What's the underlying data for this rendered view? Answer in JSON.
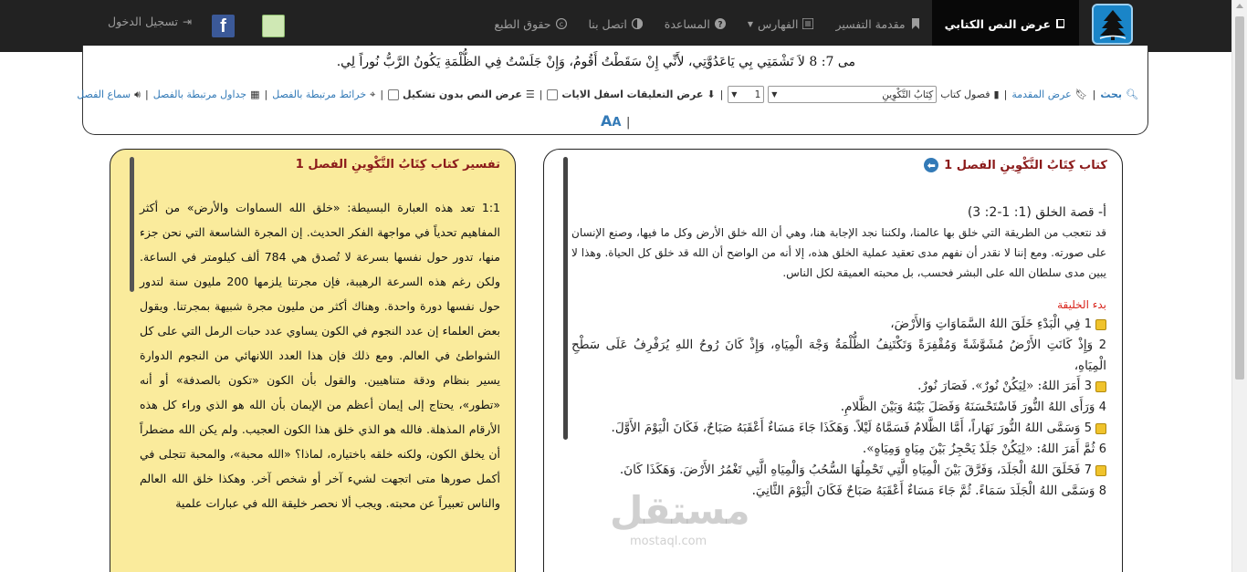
{
  "navbar": {
    "items": [
      {
        "label": "عرض النص الكتابي",
        "icon": "book-icon",
        "active": true
      },
      {
        "label": "مقدمة التفسير",
        "icon": "bookmark-icon"
      },
      {
        "label": "الفهارس",
        "icon": "list-icon",
        "dropdown": true
      },
      {
        "label": "المساعدة",
        "icon": "question-icon"
      },
      {
        "label": "اتصل بنا",
        "icon": "contrast-icon"
      },
      {
        "label": "حقوق الطبع",
        "icon": "copyright-icon"
      }
    ],
    "login_label": "تسجيل الدخول",
    "facebook_letter": "f"
  },
  "top": {
    "verse": "مى 7: 8 لاَ تَشْمَتِي بِي يَاعَدُوَّتِي، لأَنِّي إِنْ سَقَطْتُ أَقُومُ، وَإِنْ جَلَسْتُ فِي الظُّلْمَةِ يَكُونُ الرَّبُّ نُوراً لِي.",
    "search_label": "بحث",
    "intro_label": "عرض المقدمة",
    "chapters_label": "فصول كتاب",
    "book_select": "كِتَابُ التَّكْوِينِ",
    "chapter_select": "1",
    "notes_label": "عرض التعليقات اسفل الايات",
    "no_tashkeel_label": "عرض النص بدون تشكيل",
    "maps_label": "خرائط مرتبطة بالفصل",
    "tables_label": "جداول مرتبطة بالفصل",
    "audio_label": "سماع الفصل",
    "font_large": "A",
    "font_small": "A"
  },
  "right": {
    "title": "كتاب كِتَابُ التَّكْوِينِ الفصل 1",
    "section_title": "أ- قصة الخلق (1: 1-2: 3)",
    "intro": "قد نتعجب من الطريقة التي خلق بها عالمنا، ولكننا نجد الإجابة هنا، وهي أن الله خلق الأرض وكل ما فيها، وصنع الإنسان على صورته. ومع إننا لا نقدر أن نفهم مدى تعقيد عملية الخلق هذه، إلا أنه من الواضح أن الله قد خلق كل الحياة. وهذا لا يبين مدى سلطان الله على البشر فحسب، بل محبته العميقة لكل الناس.",
    "subtitle": "بدء الخليقة",
    "verses": [
      {
        "num": "1",
        "text": "فِي الْبَدْءِ خَلَقَ اللهُ السَّمَاوَاتِ وَالأَرْضَ،",
        "note": true
      },
      {
        "num": "2",
        "text": "وَإِذْ كَانَتِ الأَرْضُ مُشَوَّشَةً وَمُقْفِرَةً وَتَكْتَنِفُ الظُّلْمَةُ وَجْهَ الْمِيَاهِ، وَإِذْ كَانَ رُوحُ اللهِ يُرَفْرِفُ عَلَى سَطْحِ الْمِيَاهِ،",
        "note": false
      },
      {
        "num": "3",
        "text": "أَمَرَ اللهُ: «لِيَكُنْ نُورٌ». فَصَارَ نُورٌ.",
        "note": true
      },
      {
        "num": "4",
        "text": "وَرَأَى اللهُ النُّورَ فَاسْتَحْسَنَهُ وَفَصَلَ بَيْنَهُ وَبَيْنَ الظَّلامِ.",
        "note": false
      },
      {
        "num": "5",
        "text": "وَسَمَّى اللهُ النُّورَ نَهَاراً، أَمَّا الظَّلامُ فَسَمَّاهُ لَيْلاً. وَهَكَذَا جَاءَ مَسَاءٌ أَعْقَبَهُ صَبَاحٌ، فَكَانَ الْيَوْمَ الأَوَّلَ.",
        "note": true
      },
      {
        "num": "6",
        "text": "ثُمَّ أَمَرَ اللهُ: «لِيَكُنْ جَلَدٌ يَحْجِزُ بَيْنَ مِيَاهٍ وَمِيَاهٍ».",
        "note": false
      },
      {
        "num": "7",
        "text": "فَخَلَقَ اللهُ الْجَلَدَ، وَفَرَّقَ بَيْنَ الْمِيَاهِ الَّتِي تَحْمِلُهَا السُّحُبُ وَالْمِيَاهِ الَّتِي تَغْمُرُ الأَرْضَ. وَهَكَذَا كَانَ.",
        "note": true
      },
      {
        "num": "8",
        "text": "وَسَمَّى اللهُ الْجَلَدَ سَمَاءً. ثُمَّ جَاءَ مَسَاءٌ أَعْقَبَهُ صَبَاحٌ فَكَانَ الْيَوْمَ الثَّانِيَ.",
        "note": false
      }
    ]
  },
  "left": {
    "title": "تفسير كتاب كِتَابُ التَّكْوِينِ الفصل 1",
    "paragraph": "1:1 تعد هذه العبارة البسيطة: «خلق الله السماوات والأرض» من أكثر المفاهيم تحدياً في مواجهة الفكر الحديث. إن المجرة الشاسعة التي نحن جزء منها، تدور حول نفسها بسرعة لا تُصدق هي 784 ألف كيلومتر في الساعة. ولكن رغم هذه السرعة الرهيبة، فإن مجرتنا يلزمها 200 مليون سنة لتدور حول نفسها دورة واحدة. وهناك أكثر من مليون مجرة شبيهة بمجرتنا. ويقول بعض العلماء إن عدد النجوم في الكون يساوي عدد حبات الرمل التي على كل الشواطئ في العالم. ومع ذلك فإن هذا العدد اللانهائي من النجوم الدوارة يسير بنظام ودقة متناهيين. والقول بأن الكون «تكون بالصدفة» أو أنه «تطور»، يحتاج إلى إيمان أعظم من الإيمان بأن الله هو الذي وراء كل هذه الأرقام المذهلة. فالله هو الذي خلق هذا الكون العجيب. ولم يكن الله مضطراً أن يخلق الكون، ولكنه خلقه باختياره، لماذا؟ «الله محبة»، والمحبة تتجلى في أكمل صورها متى اتجهت لشيء آخر أو شخص آخر. وهكذا خلق الله العالم والناس تعبيراً عن محبته. ويجب ألا نحصر خليقة الله في عبارات علمية"
  },
  "watermark": {
    "text": "مستقل",
    "sub": "mostaql.com"
  }
}
